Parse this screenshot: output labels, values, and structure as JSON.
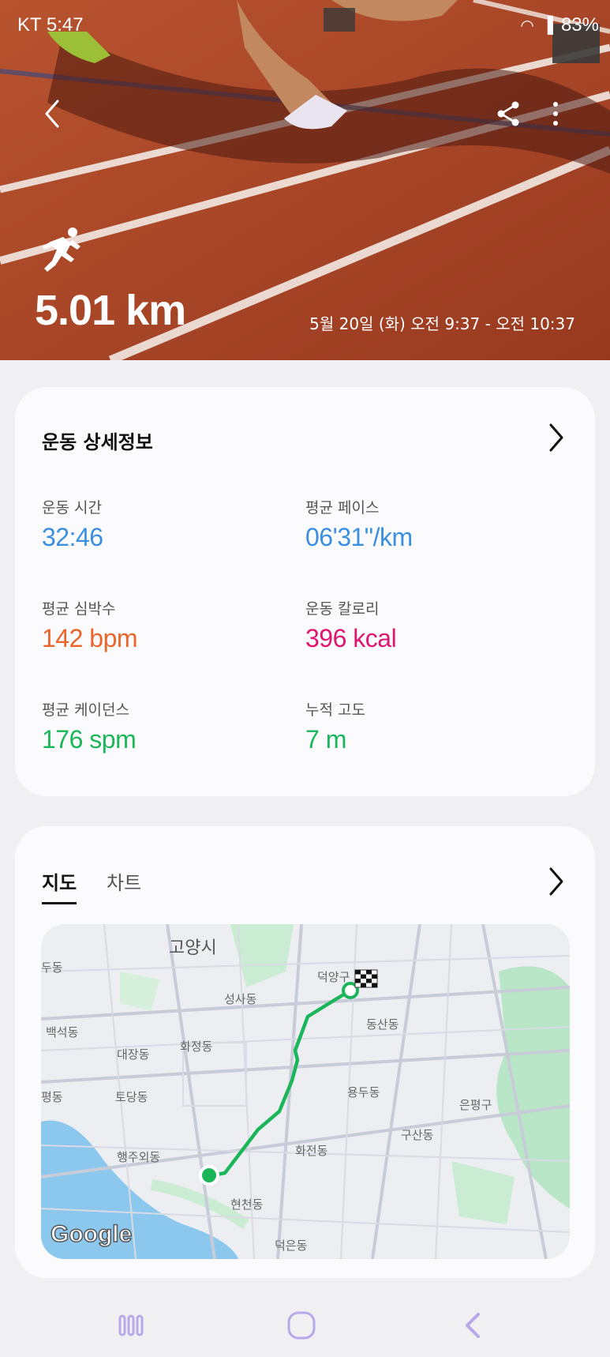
{
  "status_bar": {
    "carrier_time": "KT 5:47",
    "battery": "83%"
  },
  "hero": {
    "distance": "5.01 km",
    "datetime": "5월 20일 (화) 오전 9:37 - 오전 10:37"
  },
  "details": {
    "title": "운동 상세정보",
    "stats": [
      {
        "label": "운동 시간",
        "value": "32:46",
        "color": "#3a8fe0"
      },
      {
        "label": "평균 페이스",
        "value": "06'31\"/km",
        "color": "#3a8fe0"
      },
      {
        "label": "평균 심박수",
        "value": "142 bpm",
        "color": "#e9652a"
      },
      {
        "label": "운동 칼로리",
        "value": "396 kcal",
        "color": "#e0156f"
      },
      {
        "label": "평균 케이던스",
        "value": "176 spm",
        "color": "#1cb65a"
      },
      {
        "label": "누적 고도",
        "value": "7 m",
        "color": "#1cb65a"
      }
    ]
  },
  "map_section": {
    "tabs": [
      "지도",
      "차트"
    ],
    "labels": {
      "goyang": "고양시",
      "deogyang": "덕양구",
      "seongsa": "성사동",
      "dusong": "두동",
      "baekseok": "백석동",
      "daejang": "대장동",
      "hwajeong": "화정동",
      "dongsan": "동산동",
      "pyeong": "평동",
      "todang": "토당동",
      "yongdu": "용두동",
      "eunpyeong": "은평구",
      "gusan": "구산동",
      "haengju": "행주외동",
      "hwajeon": "화전동",
      "hyeoncheon": "현천동",
      "deogeun": "덕은동"
    },
    "attribution": "Google"
  }
}
